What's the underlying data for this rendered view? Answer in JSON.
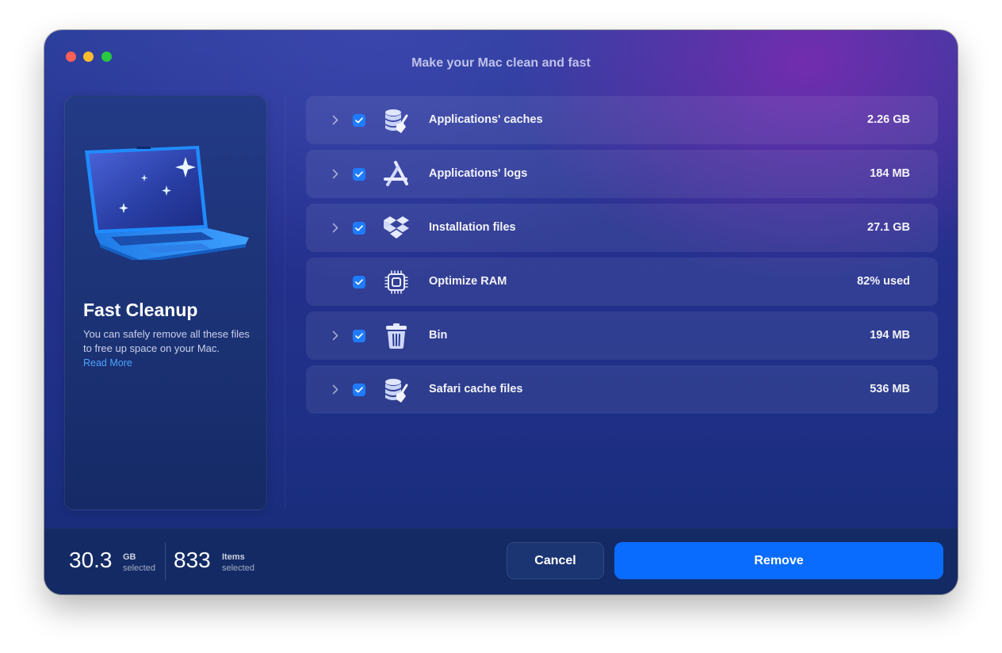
{
  "window": {
    "title": "Make your Mac clean and fast"
  },
  "sidebar": {
    "title": "Fast Cleanup",
    "description": "You can safely remove all these files to free up space on your Mac.",
    "link": "Read More"
  },
  "items": [
    {
      "label": "Applications' caches",
      "size": "2.26 GB",
      "checked": true,
      "expandable": true,
      "icon": "database-broom-icon"
    },
    {
      "label": "Applications' logs",
      "size": "184 MB",
      "checked": true,
      "expandable": true,
      "icon": "app-store-icon"
    },
    {
      "label": "Installation files",
      "size": "27.1 GB",
      "checked": true,
      "expandable": true,
      "icon": "dropbox-box-icon"
    },
    {
      "label": "Optimize RAM",
      "size": "82% used",
      "checked": true,
      "expandable": false,
      "icon": "cpu-chip-icon"
    },
    {
      "label": "Bin",
      "size": "194 MB",
      "checked": true,
      "expandable": true,
      "icon": "trash-icon"
    },
    {
      "label": "Safari cache files",
      "size": "536 MB",
      "checked": true,
      "expandable": true,
      "icon": "database-broom-icon"
    }
  ],
  "footer": {
    "size_value": "30.3",
    "size_unit": "GB",
    "size_sub": "selected",
    "items_value": "833",
    "items_unit": "Items",
    "items_sub": "selected",
    "cancel_label": "Cancel",
    "remove_label": "Remove"
  },
  "colors": {
    "accent": "#0a6cff",
    "checkbox": "#1f7bff",
    "link": "#4da2ff",
    "close": "#fe5f57",
    "minimize": "#febc2e",
    "maximize": "#28c840"
  }
}
